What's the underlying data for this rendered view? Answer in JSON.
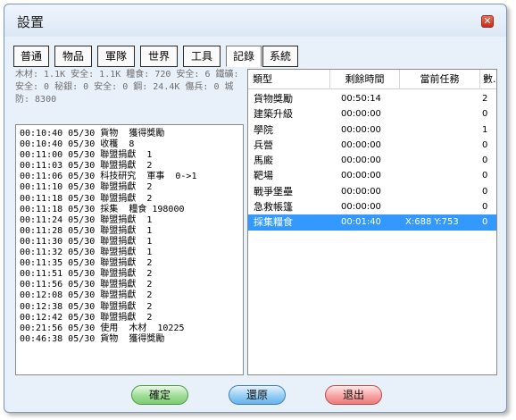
{
  "window": {
    "title": "設置",
    "close_label": "✕"
  },
  "tabs": [
    {
      "label": "普通",
      "active": false
    },
    {
      "label": "物品",
      "active": false
    },
    {
      "label": "軍隊",
      "active": false
    },
    {
      "label": "世界",
      "active": false
    },
    {
      "label": "工具",
      "active": false
    },
    {
      "label": "記錄",
      "active": true
    },
    {
      "label": "系統",
      "active": false
    }
  ],
  "stats": {
    "line1": "木材: 1.1K 安全: 1.1K  糧食: 720 安全: 6  鐵礦:",
    "line2": "安全: 0  秘銀: 0 安全: 0  鋼: 24.4K  傷兵: 0  城",
    "line3": "防: 8300"
  },
  "log": [
    "00:10:40 05/30 貨物  獲得獎勵",
    "00:10:40 05/30 收穫  8",
    "00:11:00 05/30 聯盟捐獻  1",
    "00:11:03 05/30 聯盟捐獻  2",
    "00:11:06 05/30 科技研究  軍事  0->1",
    "00:11:10 05/30 聯盟捐獻  2",
    "00:11:18 05/30 聯盟捐獻  2",
    "00:11:18 05/30 採集  糧食 198000",
    "00:11:24 05/30 聯盟捐獻  1",
    "00:11:28 05/30 聯盟捐獻  1",
    "00:11:30 05/30 聯盟捐獻  1",
    "00:11:32 05/30 聯盟捐獻  1",
    "00:11:35 05/30 聯盟捐獻  2",
    "00:11:51 05/30 聯盟捐獻  2",
    "00:11:56 05/30 聯盟捐獻  2",
    "00:12:08 05/30 聯盟捐獻  2",
    "00:12:38 05/30 聯盟捐獻  2",
    "00:12:42 05/30 聯盟捐獻  2",
    "00:21:56 05/30 使用  木材  10225",
    "00:46:38 05/30 貨物  獲得獎勵"
  ],
  "table": {
    "headers": {
      "type": "類型",
      "remaining": "剩餘時間",
      "task": "當前任務",
      "count": "數.."
    },
    "rows": [
      {
        "type": "貨物獎勵",
        "remaining": "00:50:14",
        "task": "",
        "count": "2",
        "selected": false
      },
      {
        "type": "建築升級",
        "remaining": "00:00:00",
        "task": "",
        "count": "0",
        "selected": false
      },
      {
        "type": "學院",
        "remaining": "00:00:00",
        "task": "",
        "count": "1",
        "selected": false
      },
      {
        "type": "兵營",
        "remaining": "00:00:00",
        "task": "",
        "count": "0",
        "selected": false
      },
      {
        "type": "馬廄",
        "remaining": "00:00:00",
        "task": "",
        "count": "0",
        "selected": false
      },
      {
        "type": "靶場",
        "remaining": "00:00:00",
        "task": "",
        "count": "0",
        "selected": false
      },
      {
        "type": "戰爭堡壘",
        "remaining": "00:00:00",
        "task": "",
        "count": "0",
        "selected": false
      },
      {
        "type": "急救帳篷",
        "remaining": "00:00:00",
        "task": "",
        "count": "0",
        "selected": false
      },
      {
        "type": "採集糧食",
        "remaining": "00:01:40",
        "task": "X:688 Y:753",
        "count": "0",
        "selected": true
      }
    ]
  },
  "buttons": {
    "ok": "確定",
    "restore": "還原",
    "exit": "退出"
  },
  "colors": {
    "selection": "#3399ff",
    "window_bg": "#e8f0fa"
  }
}
